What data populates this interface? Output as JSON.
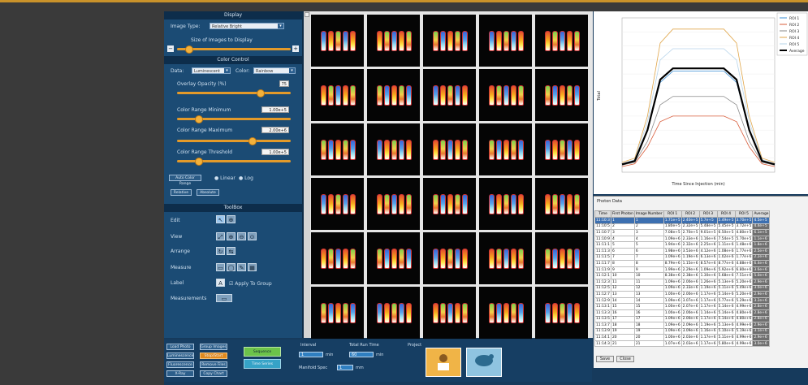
{
  "display": {
    "title": "Display",
    "image_type_label": "Image Type:",
    "image_type_value": "Relative Bright",
    "size_label": "Size of Images to Display"
  },
  "color_control": {
    "title": "Color Control",
    "data_label": "Data:",
    "data_value": "Luminescent",
    "color_label": "Color:",
    "color_value": "Rainbow",
    "overlay_label": "Overlay Opacity (%)",
    "overlay_value": "75",
    "min_label": "Color Range Minimum",
    "min_value": "1.00e+5",
    "max_label": "Color Range Maximum",
    "max_value": "2.00e+6",
    "threshold_label": "Color Range Threshold",
    "threshold_value": "1.00e+5",
    "auto_btn": "Auto Color Range",
    "scale_linear": "Linear",
    "scale_log": "Log",
    "btn_a": "Relative",
    "btn_b": "Absolute"
  },
  "toolbox": {
    "title": "ToolBox",
    "edit": "Edit",
    "view": "View",
    "arrange": "Arrange",
    "measure": "Measure",
    "label": "Label",
    "apply_group": "Apply To Group",
    "measurements": "Measurements"
  },
  "bottom": {
    "btn_load_photo": "Load Photo",
    "btn_luminescence": "Luminescence",
    "btn_fluorescence": "Fluorescence",
    "btn_xray": "X-Ray",
    "btn_group_images": "Group Images",
    "btn_stop": "Stop/Start",
    "btn_remove": "Remove Files",
    "btn_copy": "Copy Chart",
    "btn_green_top": "Sequence",
    "btn_green_bottom": "Time Series",
    "interval_label": "Interval",
    "interval_value": "1",
    "interval_unit": "min",
    "total_label": "Total Run Time",
    "total_value": "60",
    "total_unit": "min",
    "manifold_label": "Manifold Spec",
    "manifold_value": "1",
    "manifold_unit": "mm",
    "project_label": "Project"
  },
  "chart_data": {
    "type": "line",
    "xlabel": "Time Since Injection (min)",
    "ylabel": "Total",
    "x": [
      0,
      5,
      10,
      15,
      20,
      25,
      30,
      35,
      40,
      45,
      50,
      55,
      60
    ],
    "series": [
      {
        "name": "ROI 1",
        "color": "#3a8fd6",
        "values": [
          0.3,
          0.4,
          1.5,
          3.2,
          3.6,
          3.6,
          3.6,
          3.6,
          3.6,
          3.2,
          1.5,
          0.4,
          0.3
        ]
      },
      {
        "name": "ROI 2",
        "color": "#d85c3a",
        "values": [
          0.2,
          0.3,
          0.9,
          1.8,
          2.0,
          2.0,
          2.0,
          2.0,
          2.0,
          1.8,
          0.9,
          0.3,
          0.2
        ]
      },
      {
        "name": "ROI 3",
        "color": "#8a8a8a",
        "values": [
          0.25,
          0.35,
          1.1,
          2.4,
          2.7,
          2.7,
          2.7,
          2.7,
          2.7,
          2.4,
          1.1,
          0.35,
          0.25
        ]
      },
      {
        "name": "ROI 4",
        "color": "#e0a64a",
        "values": [
          0.35,
          0.5,
          2.0,
          4.6,
          5.1,
          5.1,
          5.1,
          5.1,
          5.1,
          4.6,
          2.0,
          0.5,
          0.35
        ]
      },
      {
        "name": "ROI 5",
        "color": "#b7d4ea",
        "values": [
          0.3,
          0.45,
          1.8,
          4.0,
          4.4,
          4.4,
          4.4,
          4.4,
          4.4,
          4.0,
          1.8,
          0.45,
          0.3
        ]
      },
      {
        "name": "Average",
        "color": "#000000",
        "values": [
          0.28,
          0.4,
          1.5,
          3.3,
          3.7,
          3.7,
          3.7,
          3.7,
          3.7,
          3.3,
          1.5,
          0.4,
          0.28
        ]
      }
    ]
  },
  "table": {
    "title": "Photon Data",
    "headers": [
      "Time",
      "First Photon",
      "Image Number",
      "ROI 1",
      "ROI 2",
      "ROI 3",
      "ROI 4",
      "ROI 5",
      "Average"
    ],
    "rows": [
      [
        "11:10:3",
        "1",
        "1",
        "1.71e+5",
        "2.40e+5",
        "5.7e+5",
        "5.49e+5",
        "3.70e+5",
        "4.5e+5"
      ],
      [
        "11:10:5",
        "2",
        "2",
        "1.80e+5",
        "2.32e+5",
        "5.48e+5",
        "5.45e+5",
        "3.72e+5",
        "4.4e+5"
      ],
      [
        "11:10:7",
        "3",
        "3",
        "7.08e+5",
        "2.70e+5",
        "9.01e+5",
        "6.50e+5",
        "4.80e+5",
        "6.1e+5"
      ],
      [
        "11:10:9",
        "4",
        "4",
        "1.09e+6",
        "2.33e+6",
        "1.16e+6",
        "7.54e+5",
        "5.70e+5",
        "1.1e+6"
      ],
      [
        "11:11:1",
        "5",
        "5",
        "1.94e+6",
        "2.32e+6",
        "2.25e+6",
        "1.11e+6",
        "1.48e+6",
        "1.8e+6"
      ],
      [
        "11:11:3",
        "6",
        "6",
        "1.98e+6",
        "3.53e+6",
        "4.12e+6",
        "1.08e+6",
        "1.77e+6",
        "2.5e+6"
      ],
      [
        "11:11:5",
        "7",
        "7",
        "1.09e+6",
        "1.19e+6",
        "6.13e+6",
        "1.02e+6",
        "1.77e+6",
        "2.2e+6"
      ],
      [
        "11:11:7",
        "8",
        "8",
        "8.79e+6",
        "1.15e+6",
        "8.57e+6",
        "8.77e+6",
        "4.88e+6",
        "6.4e+6"
      ],
      [
        "11:11:9",
        "9",
        "9",
        "1.99e+6",
        "2.29e+6",
        "1.09e+6",
        "5.92e+6",
        "6.80e+6",
        "3.6e+6"
      ],
      [
        "11:12:1",
        "10",
        "10",
        "8.38e+6",
        "2.38e+6",
        "1.30e+6",
        "5.68e+6",
        "7.51e+6",
        "5.0e+6"
      ],
      [
        "11:12:3",
        "11",
        "11",
        "1.09e+6",
        "2.00e+6",
        "1.26e+6",
        "5.13e+6",
        "5.20e+6",
        "2.9e+6"
      ],
      [
        "11:12:5",
        "12",
        "12",
        "1.09e+6",
        "2.33e+6",
        "1.19e+6",
        "5.11e+6",
        "5.49e+6",
        "3.0e+6"
      ],
      [
        "11:12:7",
        "13",
        "13",
        "1.00e+6",
        "2.00e+6",
        "1.17e+6",
        "5.14e+6",
        "5.20e+6",
        "2.9e+6"
      ],
      [
        "11:12:9",
        "14",
        "14",
        "1.09e+6",
        "3.07e+6",
        "1.17e+6",
        "5.77e+6",
        "5.29e+6",
        "3.2e+6"
      ],
      [
        "11:13:1",
        "15",
        "15",
        "1.00e+6",
        "2.07e+6",
        "1.17e+6",
        "5.14e+6",
        "4.99e+6",
        "2.8e+6"
      ],
      [
        "11:13:3",
        "16",
        "16",
        "1.00e+6",
        "2.00e+6",
        "1.14e+6",
        "5.14e+6",
        "4.80e+6",
        "2.8e+6"
      ],
      [
        "11:13:5",
        "17",
        "17",
        "1.09e+6",
        "2.00e+6",
        "1.17e+6",
        "5.14e+6",
        "4.80e+6",
        "2.8e+6"
      ],
      [
        "11:13:7",
        "18",
        "18",
        "1.09e+6",
        "2.09e+6",
        "1.19e+6",
        "5.13e+6",
        "4.99e+6",
        "2.9e+6"
      ],
      [
        "11:13:9",
        "19",
        "19",
        "1.09e+6",
        "3.09e+6",
        "1.16e+6",
        "5.10e+6",
        "5.19e+6",
        "3.1e+6"
      ],
      [
        "11:14:1",
        "20",
        "20",
        "1.00e+6",
        "2.03e+6",
        "1.17e+6",
        "5.11e+6",
        "4.99e+6",
        "2.9e+6"
      ],
      [
        "11:14:3",
        "21",
        "21",
        "1.07e+6",
        "2.03e+6",
        "1.17e+6",
        "5.80e+6",
        "4.99e+6",
        "3.0e+6"
      ]
    ],
    "btn_save": "Save",
    "btn_close": "Close"
  }
}
